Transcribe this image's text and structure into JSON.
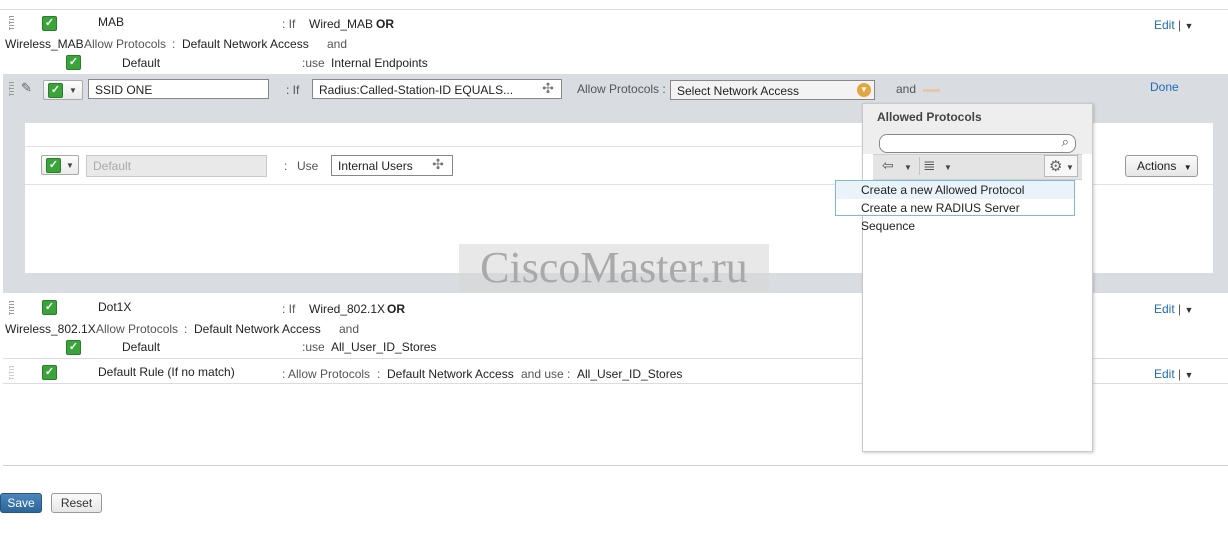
{
  "rules": {
    "mab": {
      "name": "MAB",
      "if_label": ": If",
      "condition": "Wired_MAB",
      "or_label": "OR",
      "condition2": "Wireless_MAB",
      "allow_label": "Allow Protocols",
      "allow_sep": ":",
      "allow_value": "Default Network Access",
      "and_label": "and",
      "sub_name": "Default",
      "use_label": ":use",
      "use_value": "Internal Endpoints",
      "edit_label": "Edit",
      "edit_sep": "|"
    },
    "ssid": {
      "name_value": "SSID ONE",
      "if_label": ": If",
      "condition_value": "Radius:Called-Station-ID EQUALS...",
      "allow_label": "Allow Protocols :",
      "allow_select": "Select Network Access",
      "and_label": "and",
      "done_label": "Done",
      "inner": {
        "name_placeholder": "Default",
        "use_sep": ":",
        "use_label": "Use",
        "use_value": "Internal Users",
        "actions_label": "Actions"
      }
    },
    "dot1x": {
      "name": "Dot1X",
      "if_label": ": If",
      "condition": "Wired_802.1X",
      "or_label": "OR",
      "condition2": "Wireless_802.1X",
      "allow_label": "Allow Protocols",
      "allow_sep": ":",
      "allow_value": "Default Network Access",
      "and_label": "and",
      "sub_name": "Default",
      "use_label": ":use",
      "use_value": "All_User_ID_Stores",
      "edit_label": "Edit",
      "edit_sep": "|"
    },
    "default_rule": {
      "name": "Default Rule (If no match)",
      "allow_label": ": Allow Protocols",
      "allow_sep": ":",
      "allow_value": "Default Network Access",
      "and_use_label": "and use :",
      "use_value": "All_User_ID_Stores",
      "edit_label": "Edit",
      "edit_sep": "|"
    }
  },
  "popup": {
    "title": "Allowed Protocols",
    "menu": [
      "Create a new Allowed Protocol",
      "Create a new RADIUS Server Sequence"
    ]
  },
  "watermark": "CiscoMaster.ru",
  "footer": {
    "save_label": "Save",
    "reset_label": "Reset"
  },
  "colors": {
    "link": "#1f6bb5",
    "check": "#3aa43a",
    "panel_bg": "#d9dde1",
    "save_bg": "#2f6ea4"
  },
  "icons": [
    "grip-icon",
    "checkbox-icon",
    "pencil-icon",
    "plus-icon",
    "chevron-down-icon",
    "search-icon",
    "back-arrow-icon",
    "list-icon",
    "gear-icon"
  ]
}
